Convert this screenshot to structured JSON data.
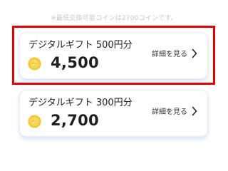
{
  "notice": "※最低交換可能コインは2700コインです。",
  "cards": [
    {
      "title": "デジタルギフト 500円分",
      "coin_amount": "4,500",
      "details_label": "詳細を見る"
    },
    {
      "title": "デジタルギフト 300円分",
      "coin_amount": "2,700",
      "details_label": "詳細を見る"
    }
  ],
  "colors": {
    "highlight_border": "#e30000",
    "coin_gold": "#f3c52b",
    "card_shadow": "#4678c8"
  },
  "icons": {
    "coin": "coin-icon",
    "details": "chevron-right-icon"
  }
}
